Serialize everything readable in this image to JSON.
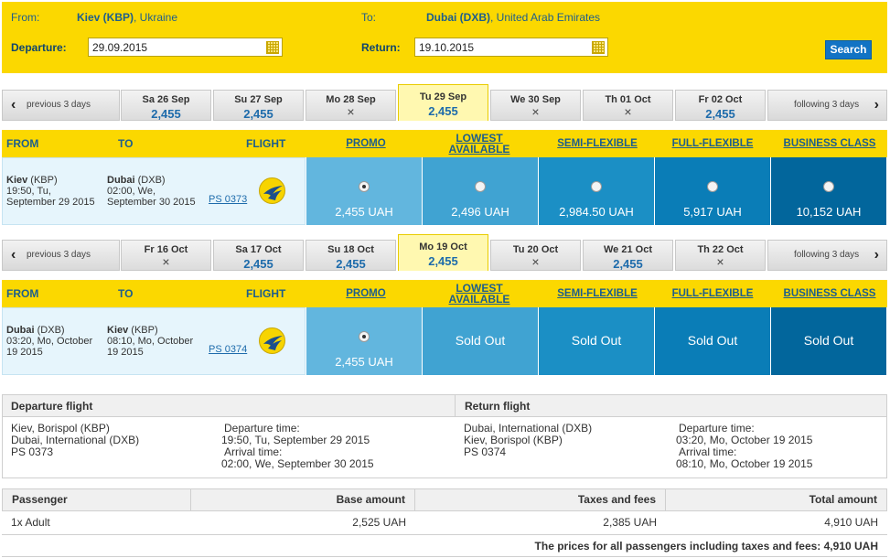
{
  "search": {
    "from_label": "From:",
    "from_city": "Kiev (KBP)",
    "from_country": ", Ukraine",
    "to_label": "To:",
    "to_city": "Dubai (DXB)",
    "to_country": ", United Arab Emirates",
    "departure_label": "Departure:",
    "departure_value": "29.09.2015",
    "return_label": "Return:",
    "return_value": "19.10.2015",
    "search_button": "Search"
  },
  "nav": {
    "prev": "previous 3 days",
    "next": "following 3 days"
  },
  "outbound": {
    "days": [
      {
        "label": "Sa 26 Sep",
        "price": "2,455",
        "available": true,
        "selected": false
      },
      {
        "label": "Su 27 Sep",
        "price": "2,455",
        "available": true,
        "selected": false
      },
      {
        "label": "Mo 28 Sep",
        "price": "",
        "available": false,
        "selected": false
      },
      {
        "label": "Tu 29 Sep",
        "price": "2,455",
        "available": true,
        "selected": true
      },
      {
        "label": "We 30 Sep",
        "price": "",
        "available": false,
        "selected": false
      },
      {
        "label": "Th 01 Oct",
        "price": "",
        "available": false,
        "selected": false
      },
      {
        "label": "Fr 02 Oct",
        "price": "2,455",
        "available": true,
        "selected": false
      }
    ],
    "flight": {
      "from_city": "Kiev",
      "from_code": " (KBP)",
      "from_time": "19:50, Tu,",
      "from_date": "September 29 2015",
      "to_city": "Dubai",
      "to_code": " (DXB)",
      "to_time": "02:00, We,",
      "to_date": "September 30 2015",
      "number": "PS 0373"
    },
    "fares": [
      {
        "text": "2,455 UAH",
        "selected": true
      },
      {
        "text": "2,496 UAH",
        "selected": false
      },
      {
        "text": "2,984.50 UAH",
        "selected": false
      },
      {
        "text": "5,917 UAH",
        "selected": false
      },
      {
        "text": "10,152 UAH",
        "selected": false
      }
    ]
  },
  "return": {
    "days": [
      {
        "label": "Fr 16 Oct",
        "price": "",
        "available": false,
        "selected": false
      },
      {
        "label": "Sa 17 Oct",
        "price": "2,455",
        "available": true,
        "selected": false
      },
      {
        "label": "Su 18 Oct",
        "price": "2,455",
        "available": true,
        "selected": false
      },
      {
        "label": "Mo 19 Oct",
        "price": "2,455",
        "available": true,
        "selected": true
      },
      {
        "label": "Tu 20 Oct",
        "price": "",
        "available": false,
        "selected": false
      },
      {
        "label": "We 21 Oct",
        "price": "2,455",
        "available": true,
        "selected": false
      },
      {
        "label": "Th 22 Oct",
        "price": "",
        "available": false,
        "selected": false
      }
    ],
    "flight": {
      "from_city": "Dubai",
      "from_code": " (DXB)",
      "from_time": "03:20, Mo, October",
      "from_date": "19 2015",
      "to_city": "Kiev",
      "to_code": " (KBP)",
      "to_time": "08:10, Mo, October",
      "to_date": "19 2015",
      "number": "PS 0374"
    },
    "fares": [
      {
        "text": "2,455 UAH",
        "selected": true
      },
      {
        "text": "Sold Out",
        "sold": true
      },
      {
        "text": "Sold Out",
        "sold": true
      },
      {
        "text": "Sold Out",
        "sold": true
      },
      {
        "text": "Sold Out",
        "sold": true
      }
    ]
  },
  "columns": {
    "from": "FROM",
    "to": "TO",
    "flight": "FLIGHT",
    "promo": "PROMO",
    "lowest_1": "LOWEST",
    "lowest_2": "AVAILABLE",
    "semi": "SEMI-FLEXIBLE",
    "full": "FULL-FLEXIBLE",
    "business": "BUSINESS CLASS"
  },
  "summary": {
    "departure_title": "Departure flight",
    "return_title": "Return flight",
    "dep": {
      "line1": "Kiev, Borispol (KBP)",
      "line2": "Dubai, International (DXB)",
      "line3": "PS 0373",
      "dep_label": "Departure time:",
      "dep_value": "19:50, Tu, September 29 2015",
      "arr_label": "Arrival time:",
      "arr_value": "02:00, We, September 30 2015"
    },
    "ret": {
      "line1": "Dubai, International (DXB)",
      "line2": "Kiev, Borispol (KBP)",
      "line3": "PS 0374",
      "dep_label": "Departure time:",
      "dep_value": "03:20, Mo, October 19 2015",
      "arr_label": "Arrival time:",
      "arr_value": "08:10, Mo, October 19 2015"
    }
  },
  "price": {
    "headers": [
      "Passenger",
      "Base amount",
      "Taxes and fees",
      "Total amount"
    ],
    "row": [
      "1x Adult",
      "2,525 UAH",
      "2,385 UAH",
      "4,910 UAH"
    ],
    "total_label": "The prices for all passengers including taxes and fees: 4,910 UAH"
  },
  "colors": {
    "yellow": "#fbd800",
    "blue_text": "#1d5e8c",
    "fare_shades": [
      "#62b6de",
      "#40a3d2",
      "#1b8fc5",
      "#0a7db7",
      "#02669c"
    ]
  },
  "icons": {
    "calendar": "calendar-icon",
    "prev": "chevron-left-icon",
    "next": "chevron-right-icon",
    "unavailable": "cross-icon",
    "logo": "airline-logo-icon"
  }
}
